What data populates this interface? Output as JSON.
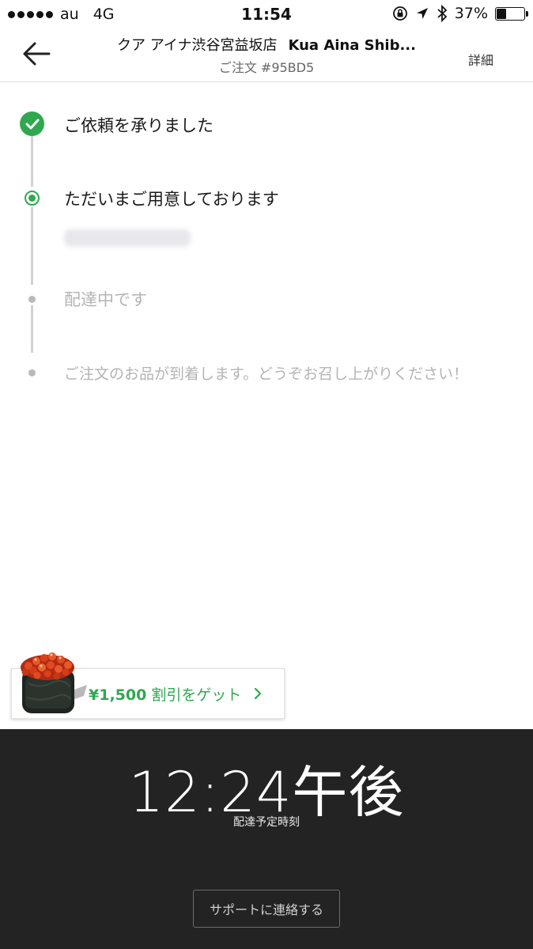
{
  "status_bar": {
    "carrier": "au",
    "network": "4G",
    "time": "11:54",
    "battery_text": "37%",
    "battery_level": 0.37,
    "icons": [
      "signal-dots-icon",
      "orientation-lock-icon",
      "location-arrow-icon",
      "bluetooth-icon",
      "battery-icon"
    ]
  },
  "header": {
    "back_icon": "arrow-left-icon",
    "restaurant_name_ja": "クア アイナ渋谷宮益坂店",
    "restaurant_name_en": "Kua Aina Shib...",
    "order_number": "ご注文 #95BD5",
    "details_label": "詳細"
  },
  "timeline": {
    "steps": [
      {
        "label": "ご依頼を承りました",
        "state": "done"
      },
      {
        "label": "ただいまご用意しております",
        "state": "current"
      },
      {
        "label": "配達中です",
        "state": "pending"
      },
      {
        "label": "ご注文のお品が到着します。どうぞお召し上がりください！",
        "state": "pending"
      }
    ],
    "accent_color": "#2fa84f"
  },
  "promo": {
    "amount": "¥1,500",
    "text": "割引をゲット",
    "chevron": "chevron-right-icon",
    "color": "#2fa84f"
  },
  "eta": {
    "time": "12:24午後",
    "caption": "配達予定時刻"
  },
  "support": {
    "button_label": "サポートに連絡する"
  }
}
